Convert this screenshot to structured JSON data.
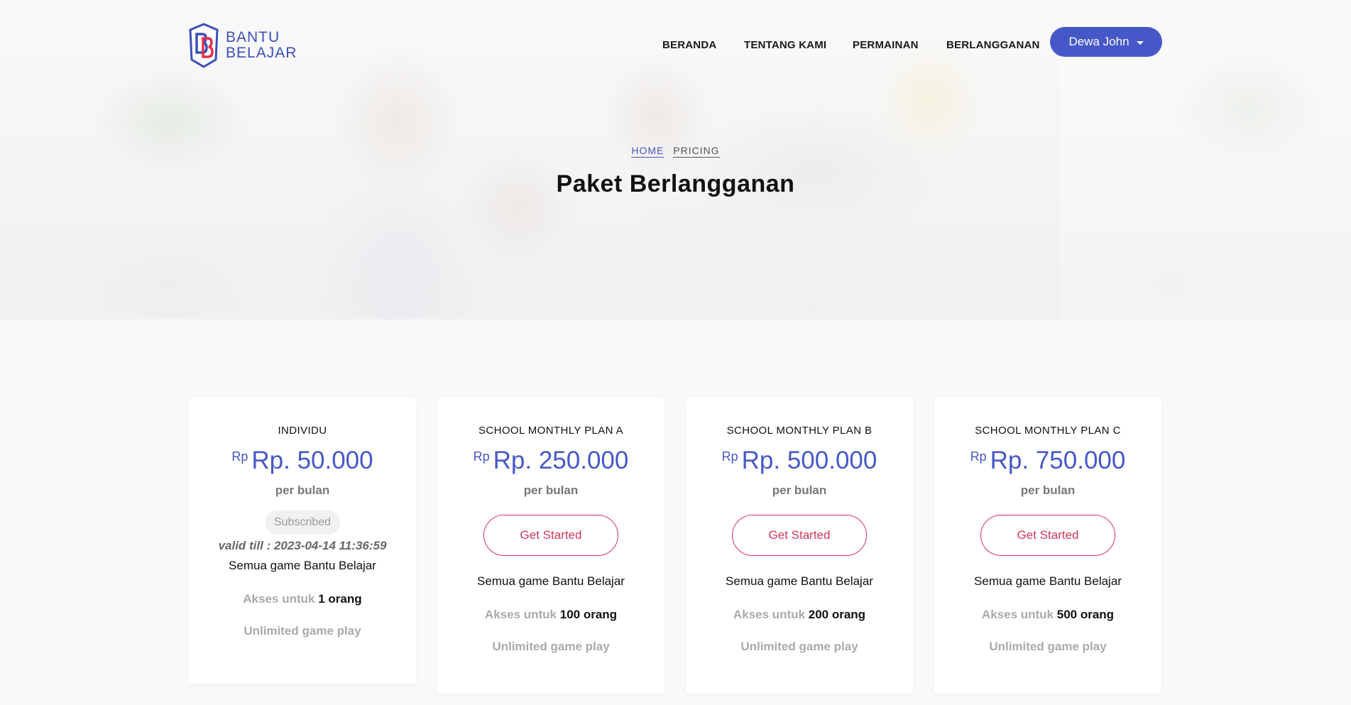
{
  "brand": {
    "logo_line1": "BANTU",
    "logo_line2": "BELAJAR",
    "logo_mark": "BB"
  },
  "nav": {
    "items": [
      "BERANDA",
      "TENTANG KAMI",
      "PERMAINAN",
      "BERLANGGANAN"
    ],
    "user": "Dewa John"
  },
  "breadcrumb": {
    "home": "HOME",
    "current": "PRICING"
  },
  "page_title": "Paket Berlangganan",
  "plans": [
    {
      "name": "INDIVIDU",
      "currency": "Rp",
      "price": "Rp. 50.000",
      "period": "per bulan",
      "status": "Subscribed",
      "valid": "valid till : 2023-04-14 11:36:59",
      "description": "Semua game Bantu Belajar",
      "access_prefix": "Akses untuk",
      "access_count": "1 orang",
      "feature": "Unlimited game play"
    },
    {
      "name": "SCHOOL MONTHLY PLAN A",
      "currency": "Rp",
      "price": "Rp. 250.000",
      "period": "per bulan",
      "cta": "Get Started",
      "description": "Semua game Bantu Belajar",
      "access_prefix": "Akses untuk",
      "access_count": "100 orang",
      "feature": "Unlimited game play"
    },
    {
      "name": "SCHOOL MONTHLY PLAN B",
      "currency": "Rp",
      "price": "Rp. 500.000",
      "period": "per bulan",
      "cta": "Get Started",
      "description": "Semua game Bantu Belajar",
      "access_prefix": "Akses untuk",
      "access_count": "200 orang",
      "feature": "Unlimited game play"
    },
    {
      "name": "SCHOOL MONTHLY PLAN C",
      "currency": "Rp",
      "price": "Rp. 750.000",
      "period": "per bulan",
      "cta": "Get Started",
      "description": "Semua game Bantu Belajar",
      "access_prefix": "Akses untuk",
      "access_count": "500 orang",
      "feature": "Unlimited game play"
    }
  ],
  "colors": {
    "accent": "#4658c8",
    "cta": "#d2365c",
    "logo_red": "#e0314f"
  }
}
